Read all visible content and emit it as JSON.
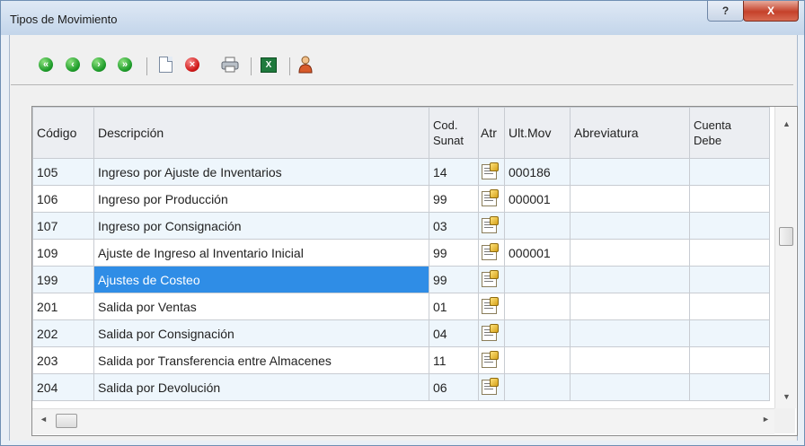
{
  "window": {
    "title": "Tipos de Movimiento",
    "help_label": "?",
    "close_label": "X"
  },
  "toolbar": {
    "buttons": [
      {
        "name": "first-record",
        "icon": "first-icon",
        "color": "#1e9c2a",
        "glyph": "«"
      },
      {
        "name": "previous-record",
        "icon": "previous-icon",
        "color": "#1e9c2a",
        "glyph": "‹"
      },
      {
        "name": "next-record",
        "icon": "next-icon",
        "color": "#1e9c2a",
        "glyph": "›"
      },
      {
        "name": "last-record",
        "icon": "last-icon",
        "color": "#1e9c2a",
        "glyph": "»"
      },
      {
        "name": "new-document",
        "icon": "new-document-icon"
      },
      {
        "name": "delete",
        "icon": "delete-icon",
        "color": "#d01818",
        "glyph": "×"
      },
      {
        "name": "print",
        "icon": "printer-icon"
      },
      {
        "name": "export-excel",
        "icon": "excel-icon",
        "glyph": "X"
      },
      {
        "name": "user",
        "icon": "user-icon"
      }
    ]
  },
  "grid": {
    "columns": [
      {
        "label": "Código"
      },
      {
        "label": "Descripción"
      },
      {
        "label": "Cod. Sunat",
        "line1": "Cod.",
        "line2": "Sunat"
      },
      {
        "label": "Atr"
      },
      {
        "label": "Ult.Mov"
      },
      {
        "label": "Abreviatura"
      },
      {
        "label": "Cuenta Debe",
        "line1": "Cuenta",
        "line2": "Debe"
      }
    ],
    "rows": [
      {
        "codigo": "105",
        "descripcion": "Ingreso por Ajuste de Inventarios",
        "sunat": "14",
        "ult_mov": "000186",
        "abreviatura": "",
        "cuenta": ""
      },
      {
        "codigo": "106",
        "descripcion": "Ingreso por Producción",
        "sunat": "99",
        "ult_mov": "000001",
        "abreviatura": "",
        "cuenta": ""
      },
      {
        "codigo": "107",
        "descripcion": "Ingreso por Consignación",
        "sunat": "03",
        "ult_mov": "",
        "abreviatura": "",
        "cuenta": ""
      },
      {
        "codigo": "109",
        "descripcion": "Ajuste de Ingreso al Inventario Inicial",
        "sunat": "99",
        "ult_mov": "000001",
        "abreviatura": "",
        "cuenta": ""
      },
      {
        "codigo": "199",
        "descripcion": "Ajustes de Costeo",
        "sunat": "99",
        "ult_mov": "",
        "abreviatura": "",
        "cuenta": "",
        "selected": true
      },
      {
        "codigo": "201",
        "descripcion": "Salida por Ventas",
        "sunat": "01",
        "ult_mov": "",
        "abreviatura": "",
        "cuenta": ""
      },
      {
        "codigo": "202",
        "descripcion": "Salida por Consignación",
        "sunat": "04",
        "ult_mov": "",
        "abreviatura": "",
        "cuenta": ""
      },
      {
        "codigo": "203",
        "descripcion": "Salida por Transferencia entre Almacenes",
        "sunat": "11",
        "ult_mov": "",
        "abreviatura": "",
        "cuenta": ""
      },
      {
        "codigo": "204",
        "descripcion": "Salida por Devolución",
        "sunat": "06",
        "ult_mov": "",
        "abreviatura": "",
        "cuenta": ""
      }
    ]
  },
  "scroll": {
    "up": "▲",
    "down": "▼",
    "left": "◄",
    "right": "►"
  },
  "colors": {
    "selection": "#2f8de6",
    "stripe": "#eef6fc",
    "title_bar": "#c3d5ea",
    "close": "#c5412a"
  }
}
